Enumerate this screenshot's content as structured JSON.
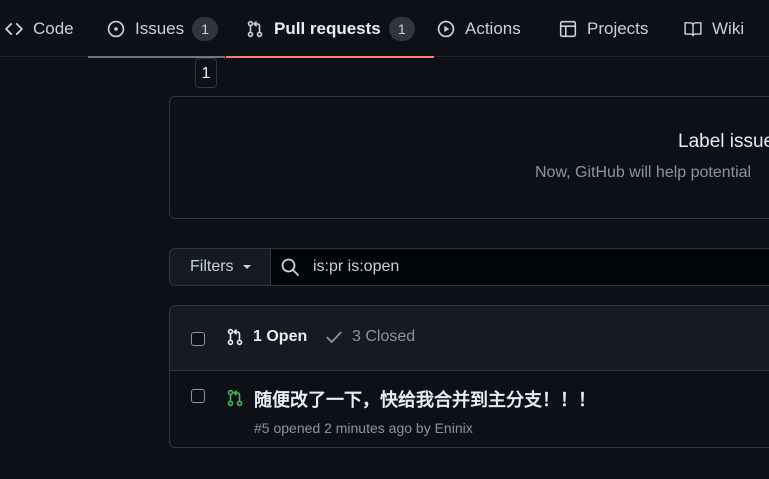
{
  "tabs": [
    {
      "label": "Code",
      "icon": "code-icon"
    },
    {
      "label": "Issues",
      "icon": "issue-opened-icon",
      "count": "1"
    },
    {
      "label": "Pull requests",
      "icon": "git-pull-request-icon",
      "count": "1",
      "active": true
    },
    {
      "label": "Actions",
      "icon": "play-icon"
    },
    {
      "label": "Projects",
      "icon": "table-icon"
    },
    {
      "label": "Wiki",
      "icon": "book-icon"
    }
  ],
  "tooltip": "1",
  "banner": {
    "title": "Label issue",
    "text": "Now, GitHub will help potential"
  },
  "filters": {
    "button_label": "Filters",
    "search_value": "is:pr is:open"
  },
  "pr_list": {
    "open_label": "1 Open",
    "closed_label": "3 Closed",
    "items": [
      {
        "title": "随便改了一下，快给我合并到主分支！！！",
        "meta": "#5 opened 2 minutes ago by Eninix"
      }
    ]
  },
  "colors": {
    "background": "#0d1117",
    "active_tab_underline": "#f78166",
    "open_pr_icon": "#3fb950",
    "border": "#30363d"
  }
}
